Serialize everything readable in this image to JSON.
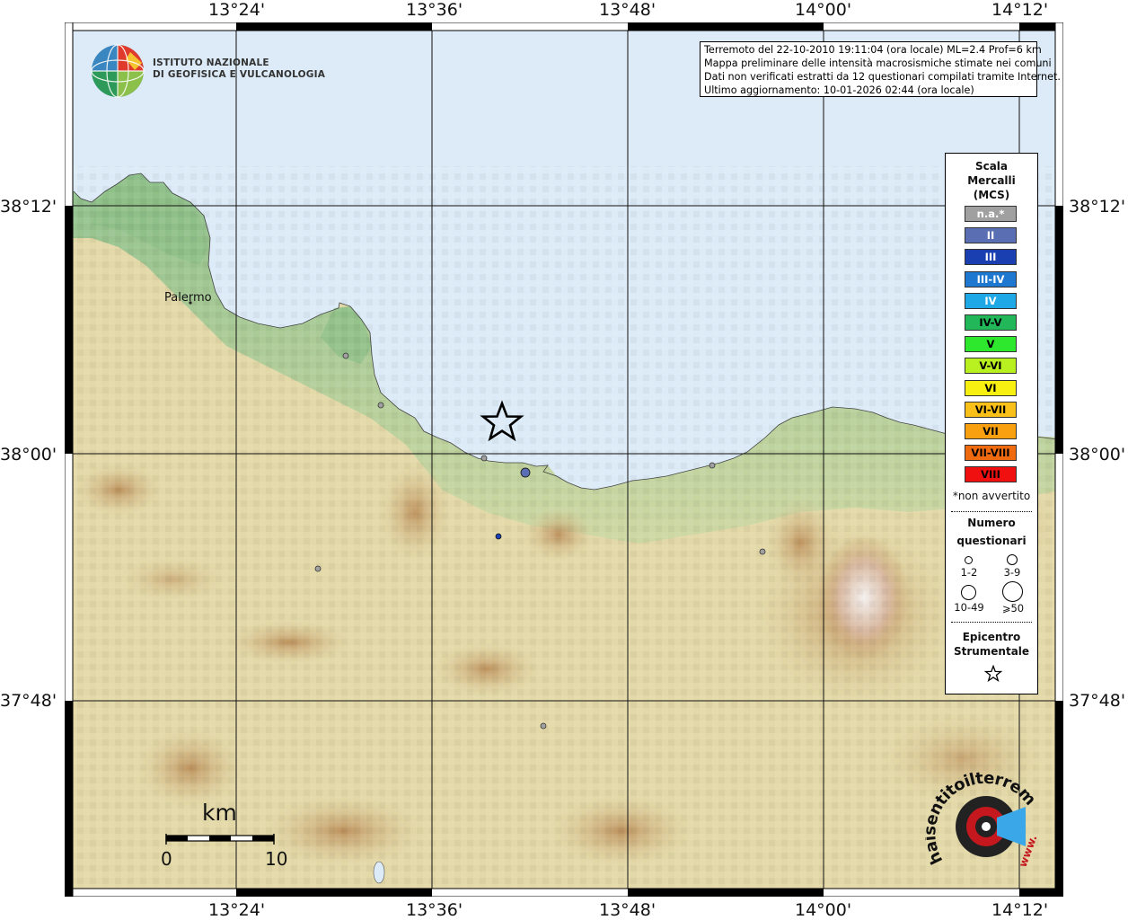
{
  "lon_labels": [
    "13°24'",
    "13°36'",
    "13°48'",
    "14°00'",
    "14°12'"
  ],
  "lat_labels": [
    "38°12'",
    "38°00'",
    "37°48'"
  ],
  "info": {
    "line1": "Terremoto del 22-10-2010 19:11:04 (ora locale) ML=2.4 Prof=6 km",
    "line2": "Mappa preliminare delle intensità macrosismiche stimate nei comuni",
    "line3": "Dati non verificati estratti da 12 questionari compilati tramite Internet.",
    "line4": "Ultimo aggiornamento: 10-01-2026 02:44 (ora locale)"
  },
  "logo": {
    "line1": "ISTITUTO NAZIONALE",
    "line2": "DI GEOFISICA E VULCANOLOGIA"
  },
  "city": "Palermo",
  "scale": {
    "unit": "km",
    "min": "0",
    "max": "10"
  },
  "legend": {
    "title1": "Scala",
    "title2": "Mercalli",
    "title3": "(MCS)",
    "items": [
      {
        "label": "n.a.*",
        "color": "#a0a0a0",
        "text": "#ffffff"
      },
      {
        "label": "II",
        "color": "#5a6fb3",
        "text": "#ffffff"
      },
      {
        "label": "III",
        "color": "#1a3fb0",
        "text": "#ffffff"
      },
      {
        "label": "III-IV",
        "color": "#1f78d0",
        "text": "#ffffff"
      },
      {
        "label": "IV",
        "color": "#1fa8e6",
        "text": "#ffffff"
      },
      {
        "label": "IV-V",
        "color": "#22b85a",
        "text": "#000000"
      },
      {
        "label": "V",
        "color": "#2ee82e",
        "text": "#000000"
      },
      {
        "label": "V-VI",
        "color": "#b8f020",
        "text": "#000000"
      },
      {
        "label": "VI",
        "color": "#f8f010",
        "text": "#000000"
      },
      {
        "label": "VI-VII",
        "color": "#f8c018",
        "text": "#000000"
      },
      {
        "label": "VII",
        "color": "#f8a010",
        "text": "#000000"
      },
      {
        "label": "VII-VIII",
        "color": "#f06a10",
        "text": "#000000"
      },
      {
        "label": "VIII",
        "color": "#f01010",
        "text": "#000000"
      }
    ],
    "note": "*non avvertito",
    "count_title1": "Numero",
    "count_title2": "questionari",
    "counts": [
      "1-2",
      "3-9",
      "10-49",
      "⩾50"
    ],
    "epi1": "Epicentro",
    "epi2": "Strumentale",
    "star_icon": "star-outline-icon"
  },
  "hsi": {
    "text": "haisentitoilterremoto.it",
    "www": "www."
  },
  "colors": {
    "sea": "#dcebf7",
    "land_low": "#9fc89a",
    "land_mid": "#e6dcb0",
    "land_high": "#c9a46b",
    "peak": "#f0ece8"
  }
}
